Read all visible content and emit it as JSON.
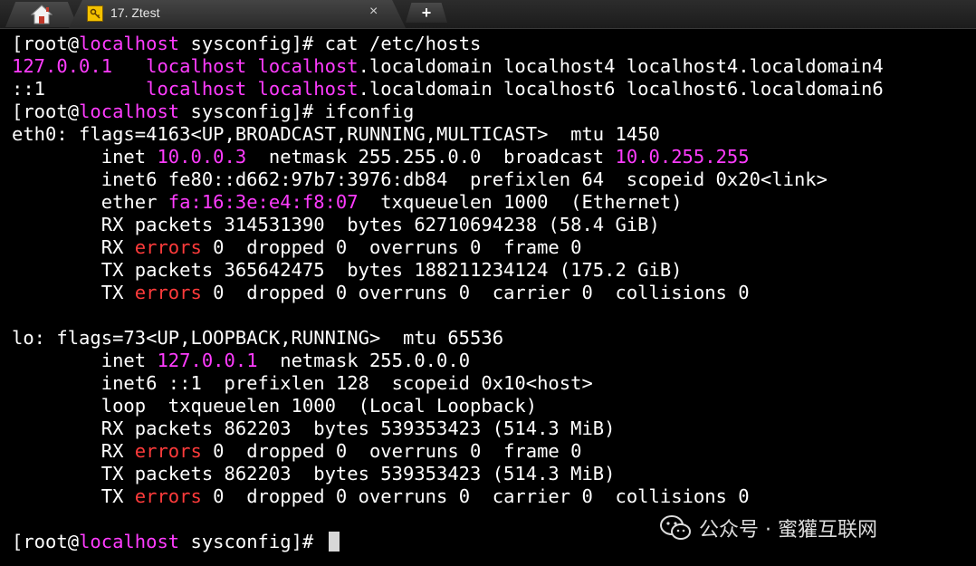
{
  "tabs": {
    "active_title": "17. Ztest",
    "close_glyph": "×",
    "new_tab_glyph": "+"
  },
  "terminal_lines": [
    [
      {
        "t": "[root@"
      },
      {
        "t": "localhost",
        "c": "m"
      },
      {
        "t": " sysconfig]# cat /etc/hosts"
      }
    ],
    [
      {
        "t": "127.0.0.1",
        "c": "m"
      },
      {
        "t": "   "
      },
      {
        "t": "localhost localhost",
        "c": "m"
      },
      {
        "t": ".localdomain localhost4 localhost4.localdomain4"
      }
    ],
    [
      {
        "t": "::1         "
      },
      {
        "t": "localhost localhost",
        "c": "m"
      },
      {
        "t": ".localdomain localhost6 localhost6.localdomain6"
      }
    ],
    [
      {
        "t": "[root@"
      },
      {
        "t": "localhost",
        "c": "m"
      },
      {
        "t": " sysconfig]# ifconfig"
      }
    ],
    [
      {
        "t": "eth0: flags=4163<UP,BROADCAST,RUNNING,MULTICAST>  mtu 1450"
      }
    ],
    [
      {
        "t": "        inet "
      },
      {
        "t": "10.0.0.3",
        "c": "m"
      },
      {
        "t": "  netmask 255.255.0.0  broadcast "
      },
      {
        "t": "10.0.255.255",
        "c": "m"
      }
    ],
    [
      {
        "t": "        inet6 fe80::d662:97b7:3976:db84  prefixlen 64  scopeid 0x20<link>"
      }
    ],
    [
      {
        "t": "        ether "
      },
      {
        "t": "fa:16:3e:e4:f8:07",
        "c": "m"
      },
      {
        "t": "  txqueuelen 1000  (Ethernet)"
      }
    ],
    [
      {
        "t": "        RX packets 314531390  bytes 62710694238 (58.4 GiB)"
      }
    ],
    [
      {
        "t": "        RX "
      },
      {
        "t": "errors",
        "c": "r"
      },
      {
        "t": " 0  dropped 0  overruns 0  frame 0"
      }
    ],
    [
      {
        "t": "        TX packets 365642475  bytes 188211234124 (175.2 GiB)"
      }
    ],
    [
      {
        "t": "        TX "
      },
      {
        "t": "errors",
        "c": "r"
      },
      {
        "t": " 0  dropped 0 overruns 0  carrier 0  collisions 0"
      }
    ],
    [
      {
        "t": ""
      }
    ],
    [
      {
        "t": "lo: flags=73<UP,LOOPBACK,RUNNING>  mtu 65536"
      }
    ],
    [
      {
        "t": "        inet "
      },
      {
        "t": "127.0.0.1",
        "c": "m"
      },
      {
        "t": "  netmask 255.0.0.0"
      }
    ],
    [
      {
        "t": "        inet6 ::1  prefixlen 128  scopeid 0x10<host>"
      }
    ],
    [
      {
        "t": "        loop  txqueuelen 1000  (Local Loopback)"
      }
    ],
    [
      {
        "t": "        RX packets 862203  bytes 539353423 (514.3 MiB)"
      }
    ],
    [
      {
        "t": "        RX "
      },
      {
        "t": "errors",
        "c": "r"
      },
      {
        "t": " 0  dropped 0  overruns 0  frame 0"
      }
    ],
    [
      {
        "t": "        TX packets 862203  bytes 539353423 (514.3 MiB)"
      }
    ],
    [
      {
        "t": "        TX "
      },
      {
        "t": "errors",
        "c": "r"
      },
      {
        "t": " 0  dropped 0 overruns 0  carrier 0  collisions 0"
      }
    ],
    [
      {
        "t": ""
      }
    ],
    [
      {
        "t": "[root@"
      },
      {
        "t": "localhost",
        "c": "m"
      },
      {
        "t": " sysconfig]# "
      },
      {
        "t": "",
        "cursor": true
      }
    ]
  ],
  "colors": {
    "background": "#000000",
    "text": "#ffffff",
    "magenta": "#ff3cff",
    "red": "#ff3b3b"
  },
  "watermark": {
    "text": "公众号 · 蜜獾互联网",
    "icon": "wechat-icon"
  }
}
